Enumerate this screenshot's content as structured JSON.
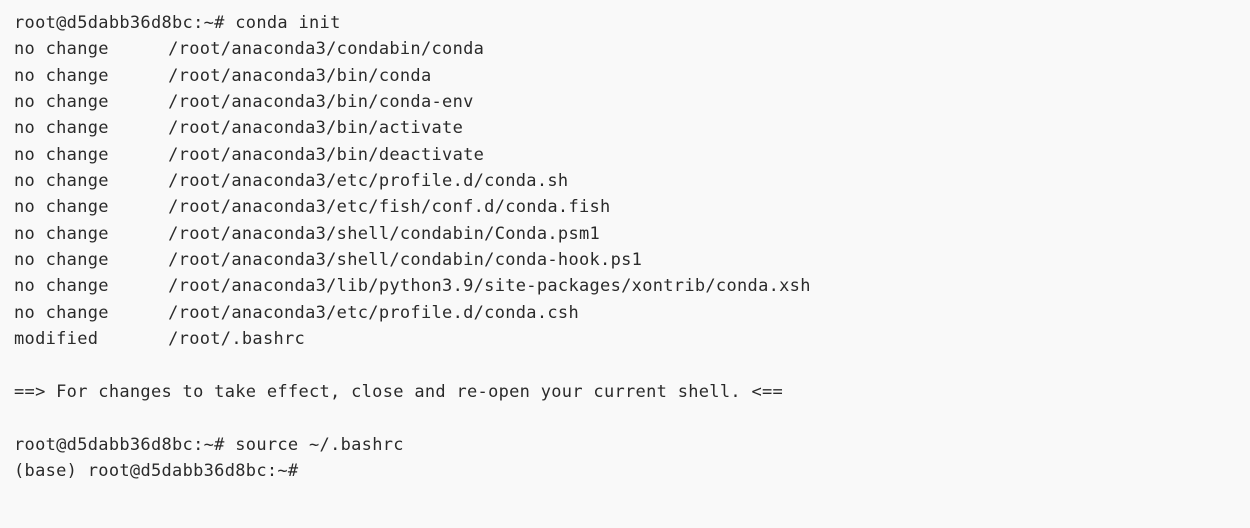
{
  "prompt1": {
    "user_host": "root@d5dabb36d8bc",
    "cwd": ":~#",
    "command": "conda init"
  },
  "lines": [
    {
      "status": "no change",
      "path": "/root/anaconda3/condabin/conda"
    },
    {
      "status": "no change",
      "path": "/root/anaconda3/bin/conda"
    },
    {
      "status": "no change",
      "path": "/root/anaconda3/bin/conda-env"
    },
    {
      "status": "no change",
      "path": "/root/anaconda3/bin/activate"
    },
    {
      "status": "no change",
      "path": "/root/anaconda3/bin/deactivate"
    },
    {
      "status": "no change",
      "path": "/root/anaconda3/etc/profile.d/conda.sh"
    },
    {
      "status": "no change",
      "path": "/root/anaconda3/etc/fish/conf.d/conda.fish"
    },
    {
      "status": "no change",
      "path": "/root/anaconda3/shell/condabin/Conda.psm1"
    },
    {
      "status": "no change",
      "path": "/root/anaconda3/shell/condabin/conda-hook.ps1"
    },
    {
      "status": "no change",
      "path": "/root/anaconda3/lib/python3.9/site-packages/xontrib/conda.xsh"
    },
    {
      "status": "no change",
      "path": "/root/anaconda3/etc/profile.d/conda.csh"
    },
    {
      "status": "modified",
      "path": "/root/.bashrc"
    }
  ],
  "notice": "==> For changes to take effect, close and re-open your current shell. <==",
  "prompt2": {
    "user_host": "root@d5dabb36d8bc",
    "cwd": ":~#",
    "command": "source ~/.bashrc"
  },
  "prompt3": {
    "env": "(base)",
    "user_host": "root@d5dabb36d8bc",
    "cwd": ":~#"
  }
}
